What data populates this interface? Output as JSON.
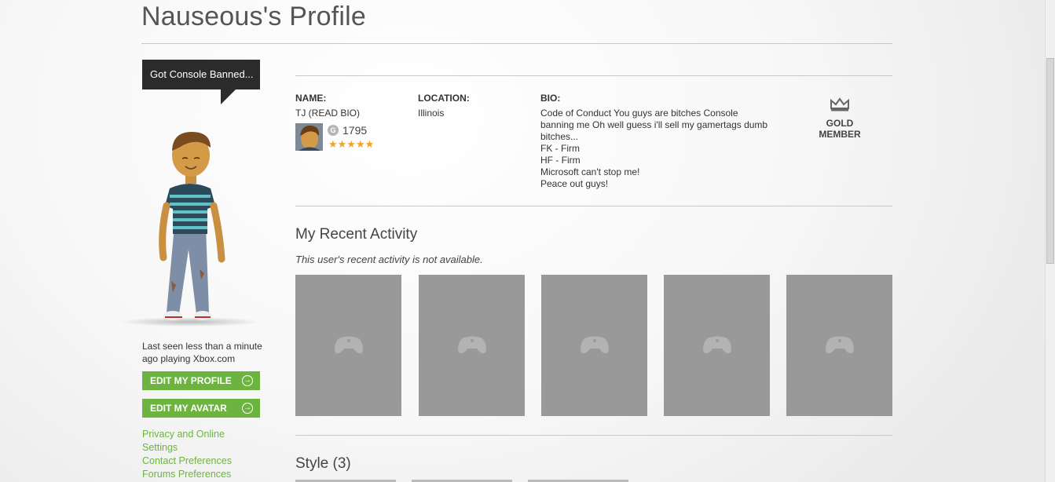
{
  "page": {
    "title": "Nauseous's Profile"
  },
  "sidebar": {
    "motto": "Got Console Banned...",
    "last_seen": "Last seen less than a minute ago playing Xbox.com",
    "edit_profile_label": "EDIT MY PROFILE",
    "edit_avatar_label": "EDIT MY AVATAR",
    "links": [
      "Privacy and Online Settings",
      "Contact Preferences",
      "Forums Preferences"
    ]
  },
  "profile": {
    "name_label": "NAME:",
    "name_value": "TJ (READ BIO)",
    "location_label": "LOCATION:",
    "location_value": "Illinois",
    "bio_label": "BIO:",
    "bio_lines": [
      "Code of Conduct    You guys are bitches Console",
      "banning me Oh well guess i'll sell my gamertags dumb",
      "bitches...",
      "FK - Firm",
      "HF - Firm",
      "Microsoft can't stop me!",
      "Peace out guys!"
    ],
    "gamerscore_badge": "G",
    "gamerscore": "1795",
    "reputation_stars": "★★★★★",
    "reputation_value": 5,
    "membership": "GOLD MEMBER",
    "accent_gold": "#f0a623"
  },
  "activity": {
    "title": "My Recent Activity",
    "note": "This user's recent activity is not available.",
    "tiles": [
      {
        "icon": "controller-icon"
      },
      {
        "icon": "controller-icon"
      },
      {
        "icon": "controller-icon"
      },
      {
        "icon": "controller-icon"
      },
      {
        "icon": "controller-icon"
      }
    ]
  },
  "style_section": {
    "title": "Style (3)"
  },
  "colors": {
    "accent_green": "#6cb43f",
    "tile_gray": "#999999",
    "motto_bg": "#2b2b2b"
  }
}
